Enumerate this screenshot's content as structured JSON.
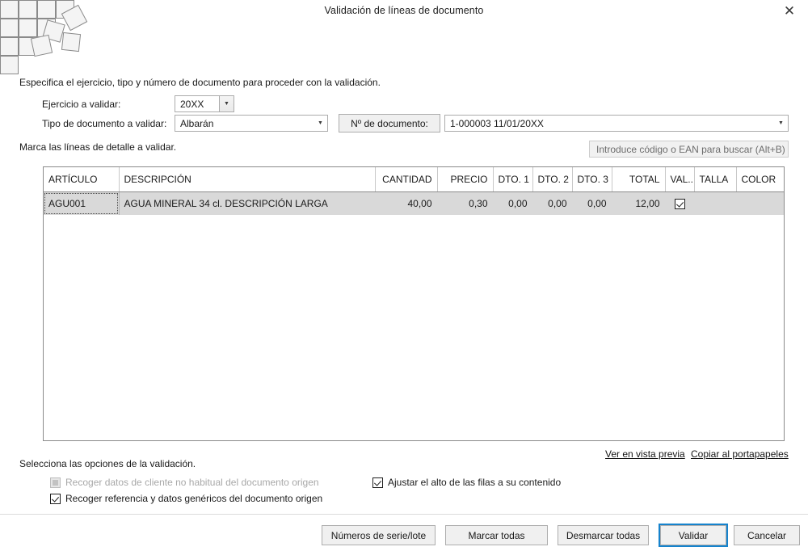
{
  "window": {
    "title": "Validación de líneas de documento",
    "close_icon": "close-icon"
  },
  "instructions": {
    "top": "Especifica el ejercicio, tipo y número de documento para proceder con la validación.",
    "lines": "Marca las líneas de detalle a validar.",
    "options": "Selecciona las opciones de la validación."
  },
  "fields": {
    "exercise_label": "Ejercicio a validar:",
    "exercise_value": "20XX",
    "doctype_label": "Tipo de documento a validar:",
    "doctype_value": "Albarán",
    "docnum_label": "Nº de documento:",
    "docnum_value": "1-000003   11/01/20XX"
  },
  "search": {
    "placeholder": "Introduce código o EAN para buscar (Alt+B)",
    "value": ""
  },
  "grid": {
    "columns": [
      {
        "label": "ARTÍCULO",
        "align": "left"
      },
      {
        "label": "DESCRIPCIÓN",
        "align": "left"
      },
      {
        "label": "CANTIDAD",
        "align": "right"
      },
      {
        "label": "PRECIO",
        "align": "right"
      },
      {
        "label": "DTO. 1",
        "align": "right"
      },
      {
        "label": "DTO. 2",
        "align": "right"
      },
      {
        "label": "DTO. 3",
        "align": "right"
      },
      {
        "label": "TOTAL",
        "align": "right"
      },
      {
        "label": "VAL...",
        "align": "left"
      },
      {
        "label": "TALLA",
        "align": "left"
      },
      {
        "label": "COLOR",
        "align": "left"
      }
    ],
    "rows": [
      {
        "articulo": "AGU001",
        "descripcion": "AGUA MINERAL 34 cl. DESCRIPCIÓN LARGA",
        "cantidad": "40,00",
        "precio": "0,30",
        "dto1": "0,00",
        "dto2": "0,00",
        "dto3": "0,00",
        "total": "12,00",
        "val": true,
        "talla": "",
        "color": ""
      }
    ]
  },
  "links": {
    "preview": "Ver en vista previa",
    "clipboard": "Copiar al portapapeles"
  },
  "options": {
    "client_data": {
      "label": "Recoger datos de cliente no habitual del documento origen",
      "checked": false,
      "disabled": true
    },
    "reference_data": {
      "label": "Recoger referencia y datos genéricos del documento origen",
      "checked": true,
      "disabled": false
    },
    "row_height": {
      "label": "Ajustar el alto de las filas a su contenido",
      "checked": true,
      "disabled": false
    }
  },
  "buttons": {
    "serial": "Números de serie/lote",
    "mark_all": "Marcar todas",
    "unmark_all": "Desmarcar todas",
    "validate": "Validar",
    "cancel": "Cancelar"
  }
}
